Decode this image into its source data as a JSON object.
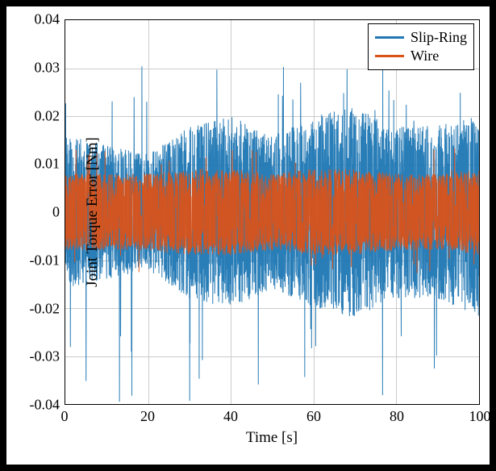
{
  "chart_data": {
    "type": "line",
    "title": "",
    "xlabel": "Time [s]",
    "ylabel": "Joint Torque Error [Nm]",
    "xlim": [
      0,
      100
    ],
    "ylim": [
      -0.04,
      0.04
    ],
    "x_ticks": [
      0,
      20,
      40,
      60,
      80,
      100
    ],
    "y_ticks": [
      -0.04,
      -0.03,
      -0.02,
      -0.01,
      0,
      0.01,
      0.02,
      0.03,
      0.04
    ],
    "y_tick_labels": [
      "-0.04",
      "-0.03",
      "-0.02",
      "-0.01",
      "0",
      "0.01",
      "0.02",
      "0.03",
      "0.04"
    ],
    "x_tick_labels": [
      "0",
      "20",
      "40",
      "60",
      "80",
      "100"
    ],
    "grid": true,
    "legend_position": "northeast",
    "series": [
      {
        "name": "Slip-Ring",
        "color": "#1f77b4",
        "description": "Dense noisy time-series, amplitude roughly ±0.015 baseline with frequent spikes reaching ±0.025 and occasional extremes near ±0.035. Slight amplitude modulation: narrower around t=15-25, broader around t=60-75.",
        "approx_envelope": {
          "x": [
            0,
            10,
            20,
            30,
            40,
            50,
            60,
            70,
            80,
            90,
            100
          ],
          "upper": [
            0.016,
            0.014,
            0.012,
            0.018,
            0.02,
            0.016,
            0.02,
            0.022,
            0.018,
            0.018,
            0.02
          ],
          "lower": [
            -0.016,
            -0.014,
            -0.012,
            -0.018,
            -0.02,
            -0.016,
            -0.02,
            -0.022,
            -0.018,
            -0.018,
            -0.022
          ],
          "spike_max": 0.031,
          "spike_min": -0.04
        }
      },
      {
        "name": "Wire",
        "color": "#d95319",
        "description": "Dense noisy time-series overlaid on Slip-Ring, smaller amplitude roughly ±0.008 with spikes to ±0.012, fairly uniform across t=0..100.",
        "approx_envelope": {
          "x": [
            0,
            10,
            20,
            30,
            40,
            50,
            60,
            70,
            80,
            90,
            100
          ],
          "upper": [
            0.008,
            0.008,
            0.008,
            0.009,
            0.009,
            0.008,
            0.009,
            0.009,
            0.008,
            0.008,
            0.009
          ],
          "lower": [
            -0.008,
            -0.008,
            -0.008,
            -0.009,
            -0.009,
            -0.008,
            -0.009,
            -0.009,
            -0.008,
            -0.008,
            -0.009
          ],
          "spike_max": 0.014,
          "spike_min": -0.013
        }
      }
    ]
  },
  "legend": {
    "items": [
      {
        "label": "Slip-Ring",
        "color": "#1f77b4"
      },
      {
        "label": "Wire",
        "color": "#d95319"
      }
    ]
  },
  "axes": {
    "xlabel": "Time [s]",
    "ylabel": "Joint Torque Error [Nm]"
  }
}
